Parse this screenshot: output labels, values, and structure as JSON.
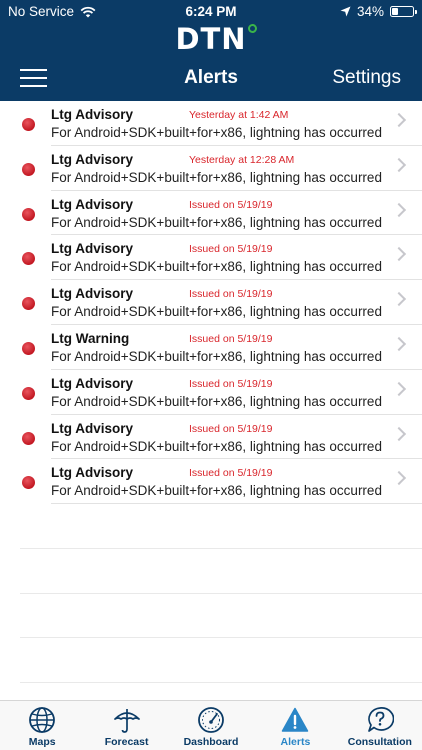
{
  "status_bar": {
    "carrier": "No Service",
    "time": "6:24 PM",
    "battery": "34%",
    "battery_level": 0.34
  },
  "header": {
    "logo": "DTN",
    "title": "Alerts",
    "settings_label": "Settings"
  },
  "alerts": [
    {
      "title": "Ltg Advisory",
      "time": "Yesterday at 1:42 AM",
      "body": "For Android+SDK+built+for+x86, lightning has occurred..."
    },
    {
      "title": "Ltg Advisory",
      "time": "Yesterday at 12:28 AM",
      "body": "For Android+SDK+built+for+x86, lightning has occurred..."
    },
    {
      "title": "Ltg Advisory",
      "time": "Issued on 5/19/19",
      "body": "For Android+SDK+built+for+x86, lightning has occurred..."
    },
    {
      "title": "Ltg Advisory",
      "time": "Issued on 5/19/19",
      "body": "For Android+SDK+built+for+x86, lightning has occurred..."
    },
    {
      "title": "Ltg Advisory",
      "time": "Issued on 5/19/19",
      "body": "For Android+SDK+built+for+x86, lightning has occurred..."
    },
    {
      "title": "Ltg Warning",
      "time": "Issued on 5/19/19",
      "body": "For Android+SDK+built+for+x86, lightning has occurred..."
    },
    {
      "title": "Ltg Advisory",
      "time": "Issued on 5/19/19",
      "body": "For Android+SDK+built+for+x86, lightning has occurred..."
    },
    {
      "title": "Ltg Advisory",
      "time": "Issued on 5/19/19",
      "body": "For Android+SDK+built+for+x86, lightning has occurred..."
    },
    {
      "title": "Ltg Advisory",
      "time": "Issued on 5/19/19",
      "body": "For Android+SDK+built+for+x86, lightning has occurred..."
    }
  ],
  "tabs": [
    {
      "label": "Maps",
      "icon": "globe-icon"
    },
    {
      "label": "Forecast",
      "icon": "umbrella-icon"
    },
    {
      "label": "Dashboard",
      "icon": "gauge-icon"
    },
    {
      "label": "Alerts",
      "icon": "warning-icon",
      "active": true
    },
    {
      "label": "Consultation",
      "icon": "question-bubble-icon"
    }
  ],
  "colors": {
    "header_bg": "#0b3b66",
    "alert_dot": "#c21822",
    "time_text": "#d9262c",
    "active_tab": "#2a86c7",
    "logo_accent": "#3ab44a"
  }
}
